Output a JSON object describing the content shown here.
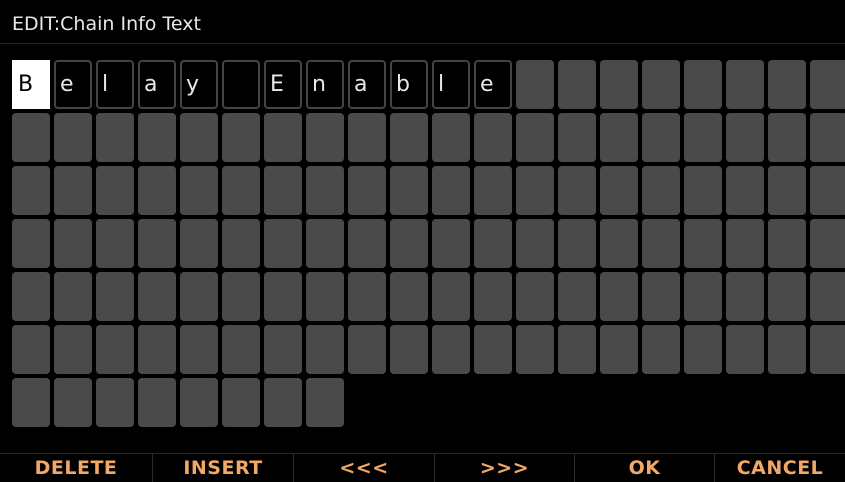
{
  "header": {
    "title": "EDIT:Chain Info Text"
  },
  "editor": {
    "characters": [
      "B",
      "e",
      "l",
      "a",
      "y",
      "",
      "E",
      "n",
      "a",
      "b",
      "l",
      "e"
    ],
    "cursor_index": 0
  },
  "softkeys": {
    "delete": "DELETE",
    "insert": "INSERT",
    "prev": "<<<",
    "next": ">>>",
    "ok": "OK",
    "cancel": "CANCEL"
  },
  "colors": {
    "softkey_text": "#f2a866",
    "empty_cell": "#4a4a4a",
    "selected_cell": "#ffffff"
  }
}
